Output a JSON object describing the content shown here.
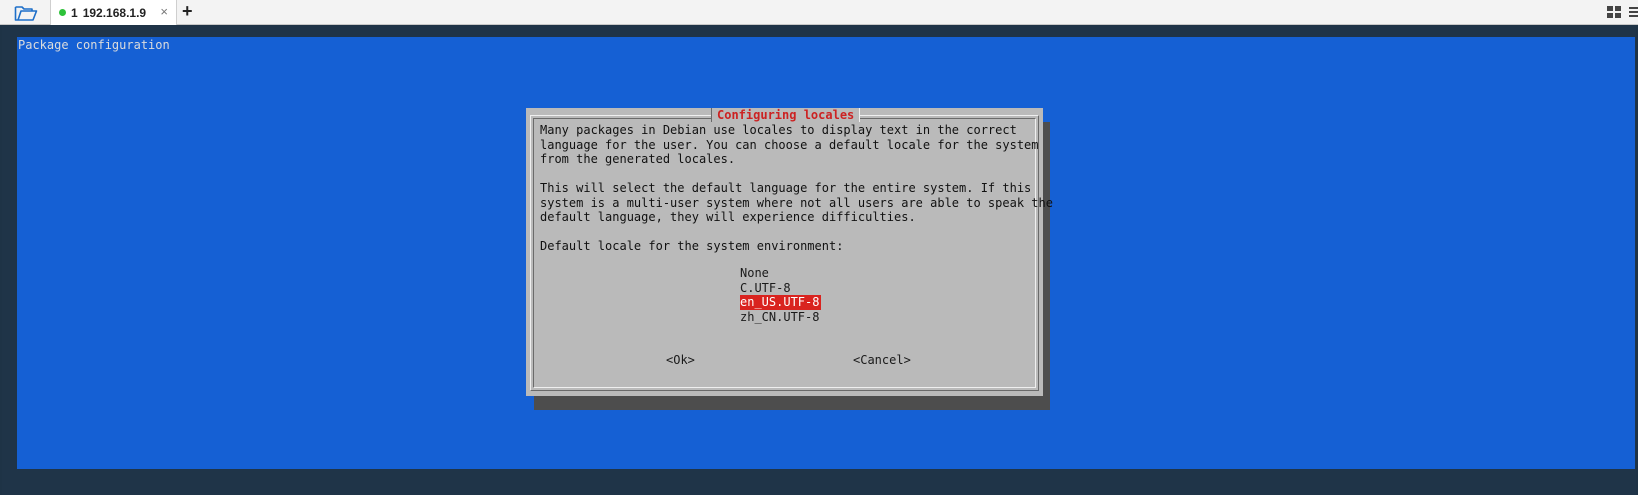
{
  "tab": {
    "number": "1",
    "title": "192.168.1.9",
    "close": "×",
    "status_color": "#2ec23a"
  },
  "toolbar": {
    "add_tab": "+"
  },
  "terminal": {
    "backtitle": "Package configuration",
    "screen_color": "#1560d4",
    "dialog": {
      "title": "Configuring locales",
      "message": "Many packages in Debian use locales to display text in the correct\nlanguage for the user. You can choose a default locale for the system\nfrom the generated locales.\n\nThis will select the default language for the entire system. If this\nsystem is a multi-user system where not all users are able to speak the\ndefault language, they will experience difficulties.\n\nDefault locale for the system environment:",
      "options": [
        "None",
        "C.UTF-8",
        "en_US.UTF-8",
        "zh_CN.UTF-8"
      ],
      "selected": "en_US.UTF-8",
      "ok_label": "<Ok>",
      "cancel_label": "<Cancel>"
    }
  }
}
